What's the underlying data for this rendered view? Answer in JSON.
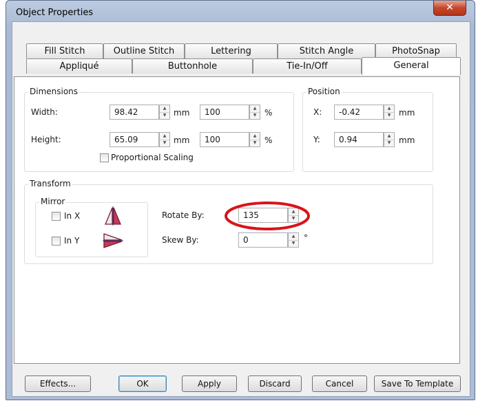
{
  "window": {
    "title": "Object Properties",
    "close_glyph": "✕"
  },
  "tabs": {
    "row1": [
      "Fill Stitch",
      "Outline Stitch",
      "Lettering",
      "Stitch Angle",
      "PhotoSnap"
    ],
    "row2": [
      "Appliqué",
      "Buttonhole",
      "Tie-In/Off",
      "General"
    ],
    "active": "General"
  },
  "dimensions": {
    "label": "Dimensions",
    "width_label": "Width:",
    "width_value": "98.42",
    "width_unit": "mm",
    "width_percent": "100",
    "height_label": "Height:",
    "height_value": "65.09",
    "height_unit": "mm",
    "height_percent": "100",
    "percent_unit": "%",
    "proportional_label": "Proportional Scaling",
    "proportional_checked": false
  },
  "position": {
    "label": "Position",
    "x_label": "X:",
    "x_value": "-0.42",
    "y_label": "Y:",
    "y_value": "0.94",
    "unit": "mm"
  },
  "transform": {
    "label": "Transform",
    "mirror_label": "Mirror",
    "in_x_label": "In X",
    "in_y_label": "In Y",
    "in_x_checked": false,
    "in_y_checked": false,
    "rotate_label": "Rotate By:",
    "rotate_value": "135",
    "skew_label": "Skew By:",
    "skew_value": "0",
    "degree_unit": "°"
  },
  "annotation": {
    "highlight_color": "#d9141b",
    "highlights": "rotate-by-field"
  },
  "buttons": {
    "effects": "Effects...",
    "ok": "OK",
    "apply": "Apply",
    "discard": "Discard",
    "cancel": "Cancel",
    "save_template": "Save To Template"
  },
  "icons": {
    "mirror_x": "mirror-horizontal-icon",
    "mirror_y": "mirror-vertical-icon",
    "spin": "spin-arrows-icon"
  }
}
